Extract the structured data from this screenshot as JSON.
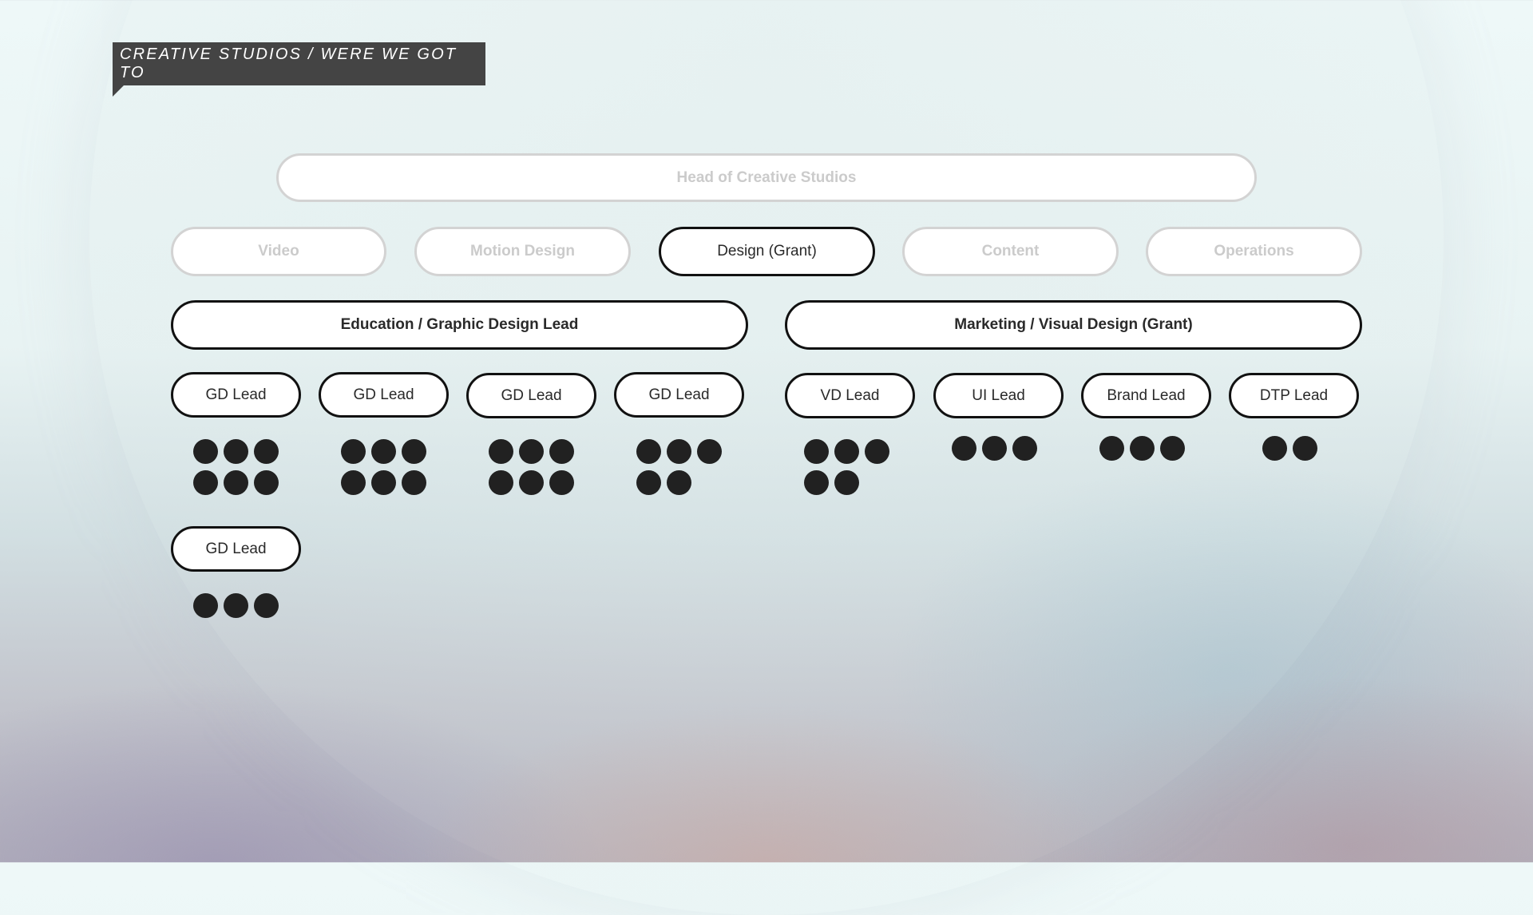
{
  "header": {
    "title": "CREATIVE STUDIOS / WERE WE GOT TO"
  },
  "org": {
    "head": "Head of Creative Studios",
    "departments": [
      {
        "label": "Video",
        "active": false
      },
      {
        "label": "Motion Design",
        "active": false
      },
      {
        "label": "Design (Grant)",
        "active": true
      },
      {
        "label": "Content",
        "active": false
      },
      {
        "label": "Operations",
        "active": false
      }
    ],
    "groups": [
      {
        "label": "Education / Graphic Design Lead"
      },
      {
        "label": "Marketing / Visual Design (Grant)"
      }
    ],
    "leads": [
      {
        "label": "GD Lead",
        "members": 6
      },
      {
        "label": "GD Lead",
        "members": 6
      },
      {
        "label": "GD Lead",
        "members": 6
      },
      {
        "label": "GD Lead",
        "members": 5
      },
      {
        "label": "VD Lead",
        "members": 5
      },
      {
        "label": "UI Lead",
        "members": 3
      },
      {
        "label": "Brand Lead",
        "members": 3
      },
      {
        "label": "DTP Lead",
        "members": 2
      },
      {
        "label": "GD Lead",
        "members": 3
      }
    ]
  },
  "colors": {
    "banner": "#444444",
    "active_border": "#111111",
    "faded_border": "#d3d3d3",
    "dot": "#212121"
  }
}
